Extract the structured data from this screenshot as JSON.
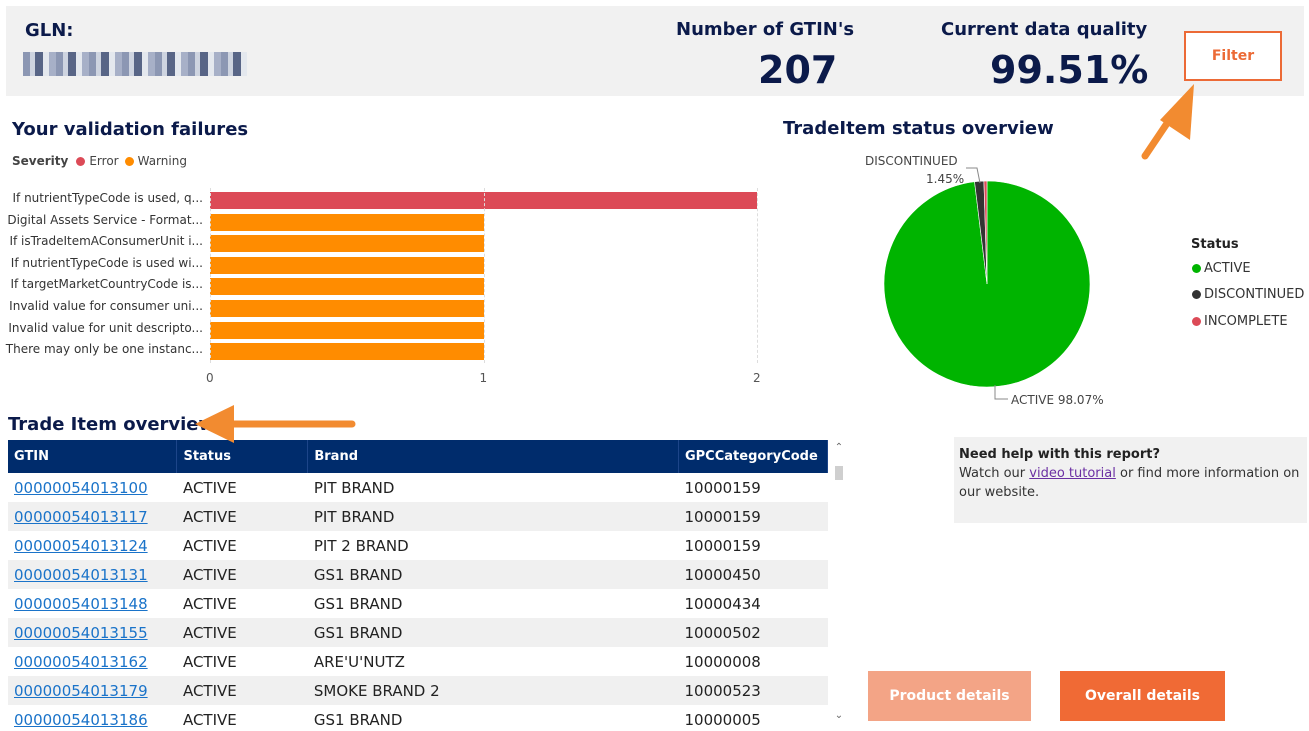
{
  "header": {
    "gln_label": "GLN:",
    "gtin_count_label": "Number of GTIN's",
    "gtin_count_value": "207",
    "quality_label": "Current data quality",
    "quality_value": "99.51%",
    "filter_label": "Filter"
  },
  "validation": {
    "title": "Your validation failures",
    "legend_title": "Severity",
    "legend_error": "Error",
    "legend_warning": "Warning",
    "error_color": "#dc4a57",
    "warning_color": "#ff8c00"
  },
  "status_chart": {
    "title": "TradeItem status overview",
    "legend_title": "Status",
    "discontinued_label": "DISCONTINUED",
    "discontinued_pct": "1.45%",
    "active_label": "ACTIVE 98.07%",
    "legend_items": [
      "ACTIVE",
      "DISCONTINUED",
      "INCOMPLETE"
    ]
  },
  "chart_data": [
    {
      "type": "bar",
      "orientation": "horizontal",
      "categories": [
        "If nutrientTypeCode is used, q...",
        "Digital Assets Service - Format...",
        "If isTradeItemAConsumerUnit i...",
        "If nutrientTypeCode is used wi...",
        "If targetMarketCountryCode is...",
        "Invalid value for consumer uni...",
        "Invalid value for unit descripto...",
        "There may only be one instanc..."
      ],
      "values": [
        2,
        1,
        1,
        1,
        1,
        1,
        1,
        1
      ],
      "severity": [
        "Error",
        "Warning",
        "Warning",
        "Warning",
        "Warning",
        "Warning",
        "Warning",
        "Warning"
      ],
      "xlim": [
        0,
        2
      ],
      "xticks": [
        "0",
        "1",
        "2"
      ]
    },
    {
      "type": "pie",
      "labels": [
        "ACTIVE",
        "DISCONTINUED",
        "INCOMPLETE"
      ],
      "values": [
        98.07,
        1.45,
        0.48
      ],
      "colors": [
        "#00b400",
        "#333333",
        "#dc4a57"
      ]
    }
  ],
  "table": {
    "title": "Trade Item overview",
    "columns": [
      "GTIN",
      "Status",
      "Brand",
      "GPCCategoryCode"
    ],
    "rows": [
      [
        "00000054013100",
        "ACTIVE",
        "PIT BRAND",
        "10000159"
      ],
      [
        "00000054013117",
        "ACTIVE",
        "PIT BRAND",
        "10000159"
      ],
      [
        "00000054013124",
        "ACTIVE",
        "PIT 2 BRAND",
        "10000159"
      ],
      [
        "00000054013131",
        "ACTIVE",
        "GS1 BRAND",
        "10000450"
      ],
      [
        "00000054013148",
        "ACTIVE",
        "GS1 BRAND",
        "10000434"
      ],
      [
        "00000054013155",
        "ACTIVE",
        "GS1 BRAND",
        "10000502"
      ],
      [
        "00000054013162",
        "ACTIVE",
        "ARE'U'NUTZ",
        "10000008"
      ],
      [
        "00000054013179",
        "ACTIVE",
        "SMOKE BRAND 2",
        "10000523"
      ],
      [
        "00000054013186",
        "ACTIVE",
        "GS1 BRAND",
        "10000005"
      ]
    ]
  },
  "help": {
    "title": "Need help with this report?",
    "text_before": "Watch our ",
    "link_text": "video tutorial",
    "text_after": " or find more information on our website."
  },
  "buttons": {
    "product_details": "Product details",
    "overall_details": "Overall details"
  },
  "annotation_color": "#f28b30"
}
